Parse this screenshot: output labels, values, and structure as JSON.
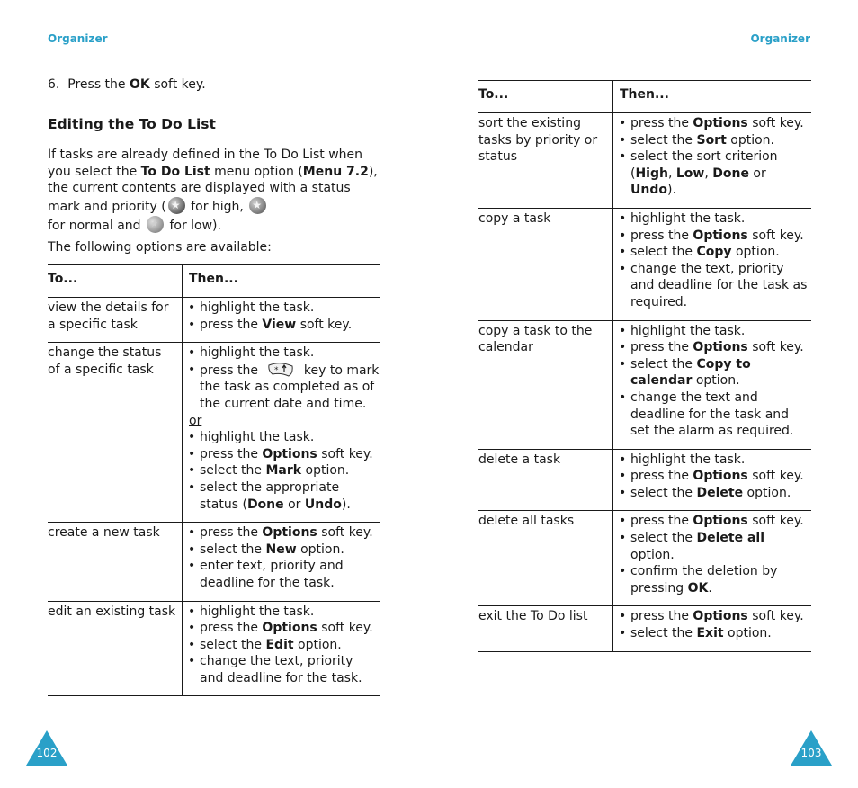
{
  "colors": {
    "accent": "#2aa0c8",
    "text": "#1a1a1a"
  },
  "left_page": {
    "running_head": "Organizer",
    "step": {
      "number": "6.",
      "pre": "Press the ",
      "bold": "OK",
      "post": " soft key."
    },
    "section_title": "Editing the To Do List",
    "intro": {
      "t1": "If tasks are already defined in the To Do List when you select the ",
      "b1": "To Do List",
      "t2": " menu option (",
      "b2": "Menu 7.2",
      "t3": "), the current contents are displayed with a status mark and priority (",
      "icon_high": "priority-high-icon",
      "t4": " for high, ",
      "icon_normal": "priority-normal-icon",
      "t5": " for normal and ",
      "icon_low": "priority-low-icon",
      "t6": " for low)."
    },
    "available": "The following options are available:",
    "table": {
      "headers": [
        "To...",
        "Then..."
      ],
      "rows": [
        {
          "to": "view the details for a specific task",
          "then": [
            [
              {
                "t": "highlight the task."
              }
            ],
            [
              {
                "t": "press the "
              },
              {
                "b": "View"
              },
              {
                "t": " soft key."
              }
            ]
          ]
        },
        {
          "to": "change the status of a specific task",
          "then": [
            [
              {
                "t": "highlight the task."
              }
            ],
            [
              {
                "t": "press the "
              },
              {
                "icon": "star-key-icon"
              },
              {
                "t": " key to mark the task as completed as of the current date and time."
              }
            ]
          ],
          "or_label": "or",
          "then_alt": [
            [
              {
                "t": "highlight the task."
              }
            ],
            [
              {
                "t": "press the "
              },
              {
                "b": "Options"
              },
              {
                "t": " soft key."
              }
            ],
            [
              {
                "t": "select the "
              },
              {
                "b": "Mark"
              },
              {
                "t": " option."
              }
            ],
            [
              {
                "t": "select the appropriate status ("
              },
              {
                "b": "Done"
              },
              {
                "t": " or "
              },
              {
                "b": "Undo"
              },
              {
                "t": ")."
              }
            ]
          ]
        },
        {
          "to": "create a new task",
          "then": [
            [
              {
                "t": "press the "
              },
              {
                "b": "Options"
              },
              {
                "t": " soft key."
              }
            ],
            [
              {
                "t": "select the "
              },
              {
                "b": "New"
              },
              {
                "t": " option."
              }
            ],
            [
              {
                "t": "enter text, priority and deadline for the task."
              }
            ]
          ]
        },
        {
          "to": "edit an existing task",
          "then": [
            [
              {
                "t": "highlight the task."
              }
            ],
            [
              {
                "t": "press the "
              },
              {
                "b": "Options"
              },
              {
                "t": " soft key."
              }
            ],
            [
              {
                "t": "select the "
              },
              {
                "b": "Edit"
              },
              {
                "t": " option."
              }
            ],
            [
              {
                "t": "change the text, priority and deadline for the task."
              }
            ]
          ]
        }
      ]
    },
    "page_number": "102"
  },
  "right_page": {
    "running_head": "Organizer",
    "table": {
      "headers": [
        "To...",
        "Then..."
      ],
      "rows": [
        {
          "to": "sort the existing tasks by priority or status",
          "then": [
            [
              {
                "t": "press the "
              },
              {
                "b": "Options"
              },
              {
                "t": " soft key."
              }
            ],
            [
              {
                "t": "select the "
              },
              {
                "b": "Sort"
              },
              {
                "t": " option."
              }
            ],
            [
              {
                "t": "select the sort criterion ("
              },
              {
                "b": "High"
              },
              {
                "t": ", "
              },
              {
                "b": "Low"
              },
              {
                "t": ", "
              },
              {
                "b": "Done"
              },
              {
                "t": " or "
              },
              {
                "b": "Undo"
              },
              {
                "t": ")."
              }
            ]
          ]
        },
        {
          "to": "copy a task",
          "then": [
            [
              {
                "t": "highlight the task."
              }
            ],
            [
              {
                "t": "press the "
              },
              {
                "b": "Options"
              },
              {
                "t": " soft key."
              }
            ],
            [
              {
                "t": "select the "
              },
              {
                "b": "Copy"
              },
              {
                "t": " option."
              }
            ],
            [
              {
                "t": "change the text, priority and deadline for the task as required."
              }
            ]
          ]
        },
        {
          "to": "copy a task to the calendar",
          "then": [
            [
              {
                "t": "highlight the task."
              }
            ],
            [
              {
                "t": "press the "
              },
              {
                "b": "Options"
              },
              {
                "t": " soft key."
              }
            ],
            [
              {
                "t": "select the "
              },
              {
                "b": "Copy to calendar"
              },
              {
                "t": " option."
              }
            ],
            [
              {
                "t": "change the text and deadline for the task and set the alarm as required."
              }
            ]
          ]
        },
        {
          "to": "delete a task",
          "then": [
            [
              {
                "t": "highlight the task."
              }
            ],
            [
              {
                "t": "press the "
              },
              {
                "b": "Options"
              },
              {
                "t": " soft key."
              }
            ],
            [
              {
                "t": "select the "
              },
              {
                "b": "Delete"
              },
              {
                "t": " option."
              }
            ]
          ]
        },
        {
          "to": "delete all tasks",
          "then": [
            [
              {
                "t": "press the "
              },
              {
                "b": "Options"
              },
              {
                "t": " soft key."
              }
            ],
            [
              {
                "t": "select the "
              },
              {
                "b": "Delete all"
              },
              {
                "t": " option."
              }
            ],
            [
              {
                "t": "confirm the deletion by pressing "
              },
              {
                "b": "OK"
              },
              {
                "t": "."
              }
            ]
          ]
        },
        {
          "to": "exit the To Do list",
          "then": [
            [
              {
                "t": "press the "
              },
              {
                "b": "Options"
              },
              {
                "t": " soft key."
              }
            ],
            [
              {
                "t": "select the "
              },
              {
                "b": "Exit"
              },
              {
                "t": " option."
              }
            ]
          ]
        }
      ]
    },
    "page_number": "103"
  }
}
